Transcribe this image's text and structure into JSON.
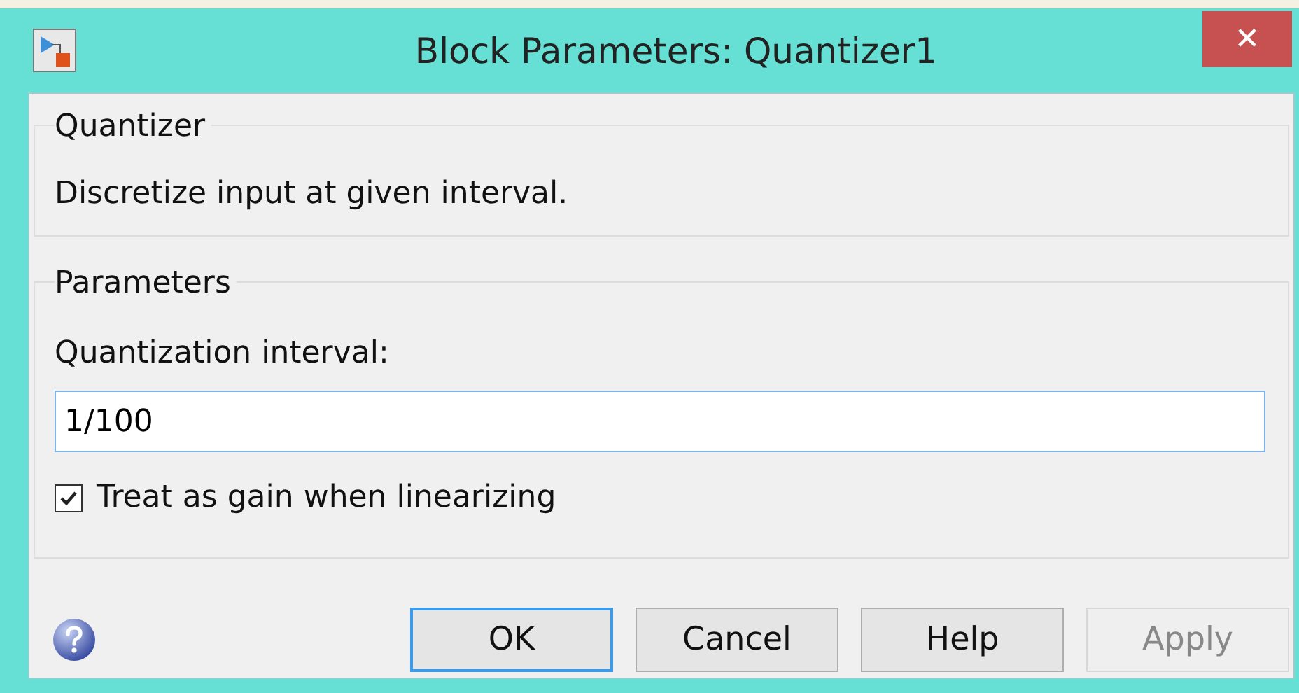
{
  "window": {
    "title": "Block Parameters: Quantizer1",
    "close_label": "✕"
  },
  "block": {
    "legend": "Quantizer",
    "description": "Discretize input at given interval."
  },
  "parameters": {
    "legend": "Parameters",
    "field_label": "Quantization interval:",
    "field_value": "1/100",
    "checkbox": {
      "label": "Treat as gain when linearizing",
      "checked": true
    }
  },
  "buttons": [
    {
      "label": "OK",
      "default": true,
      "disabled": false
    },
    {
      "label": "Cancel",
      "default": false,
      "disabled": false
    },
    {
      "label": "Help",
      "default": false,
      "disabled": false
    },
    {
      "label": "Apply",
      "default": false,
      "disabled": true
    }
  ]
}
